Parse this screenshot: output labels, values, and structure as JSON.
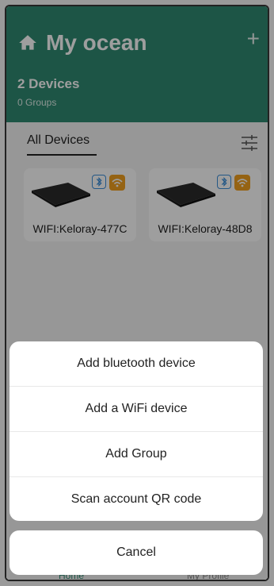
{
  "header": {
    "title": "My ocean",
    "device_count": "2 Devices",
    "group_count": "0 Groups",
    "home_icon": "home-icon",
    "add_icon": "plus-icon"
  },
  "tabs": {
    "active": "All Devices"
  },
  "devices": [
    {
      "label": "WIFI:Keloray-477C"
    },
    {
      "label": "WIFI:Keloray-48D8"
    }
  ],
  "nav": {
    "home": "Home",
    "profile": "My Profile"
  },
  "action_sheet": {
    "items": [
      "Add bluetooth device",
      "Add a WiFi device",
      "Add Group",
      "Scan account QR code"
    ],
    "cancel": "Cancel"
  },
  "colors": {
    "brand": "#2f8a72",
    "wifi_badge": "#f0a020",
    "bt_badge": "#3b8ed8"
  }
}
